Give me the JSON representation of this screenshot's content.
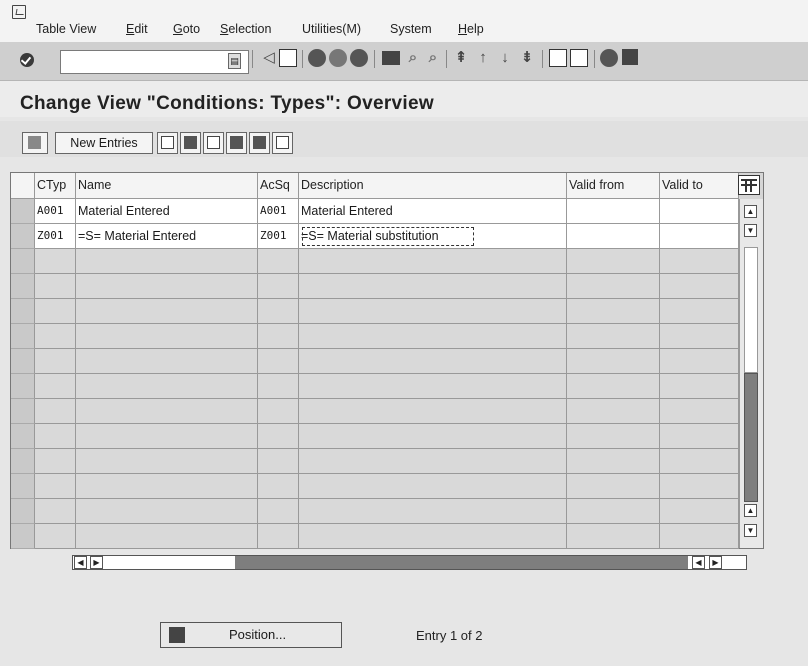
{
  "menu": [
    {
      "text": "Table View",
      "ul": ""
    },
    {
      "text": "dit",
      "ul": "E"
    },
    {
      "text": "oto",
      "ul": "G"
    },
    {
      "text": "election",
      "ul": "S"
    },
    {
      "text": "Utilities(M)",
      "ul": ""
    },
    {
      "text": "System",
      "ul": ""
    },
    {
      "text": "elp",
      "ul": "H"
    }
  ],
  "command_field": {
    "value": ""
  },
  "page_title": "Change View \"Conditions: Types\": Overview",
  "app_toolbar": {
    "new_entries_label": "New Entries"
  },
  "table": {
    "headers": [
      "CTyp",
      "Name",
      "AcSq",
      "Description",
      "Valid from",
      "Valid to"
    ],
    "rows": [
      [
        "A001",
        "Material Entered",
        "A001",
        "Material Entered",
        "",
        ""
      ],
      [
        "Z001",
        "=S= Material Entered",
        "Z001",
        "=S= Material substitution",
        "",
        ""
      ]
    ],
    "empty_row_count": 12
  },
  "position_button_label": "Position...",
  "entry_status": "Entry 1 of 2"
}
